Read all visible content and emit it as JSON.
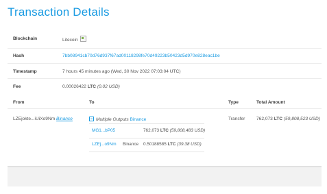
{
  "page": {
    "title": "Transaction Details"
  },
  "details": {
    "blockchain": {
      "label": "Blockchain",
      "value": "Litecoin"
    },
    "hash": {
      "label": "Hash",
      "value": "7bb08941cb70d76d937f67ad00118298fe70d49223b50423d5d970e828eac1be"
    },
    "timestamp": {
      "label": "Timestamp",
      "value": "7 hours 45 minutes ago (Wed, 30 Nov 2022 07:03:04 UTC)"
    },
    "fee": {
      "label": "Fee",
      "amount": "0.00026422",
      "unit": "LTC",
      "usd": "(0.02 USD)"
    }
  },
  "transfers": {
    "headers": {
      "from": "From",
      "to": "To",
      "type": "Type",
      "total": "Total Amount"
    },
    "row": {
      "from_addr": "LZEjokte...iUiXo9Nm",
      "from_label": "Binance",
      "to_prefix": "Multiple Outputs",
      "to_label": "Binance",
      "type": "Transfer",
      "total_amount": "762,073",
      "total_unit": "LTC",
      "total_usd": "(59,808,523 USD)"
    },
    "outputs": [
      {
        "addr": "MG1...bP05",
        "label": "",
        "amount": "762,073",
        "unit": "LTC",
        "usd": "(59,808,483 USD)"
      },
      {
        "addr": "LZEj...o9Nm",
        "label": "Binance",
        "amount": "0.50188585",
        "unit": "LTC",
        "usd": "(39.38 USD)"
      }
    ]
  },
  "icons": {
    "coin": "broken-image-icon",
    "collapse": "minus-square-icon"
  },
  "colors": {
    "accent": "#1a9be2"
  }
}
